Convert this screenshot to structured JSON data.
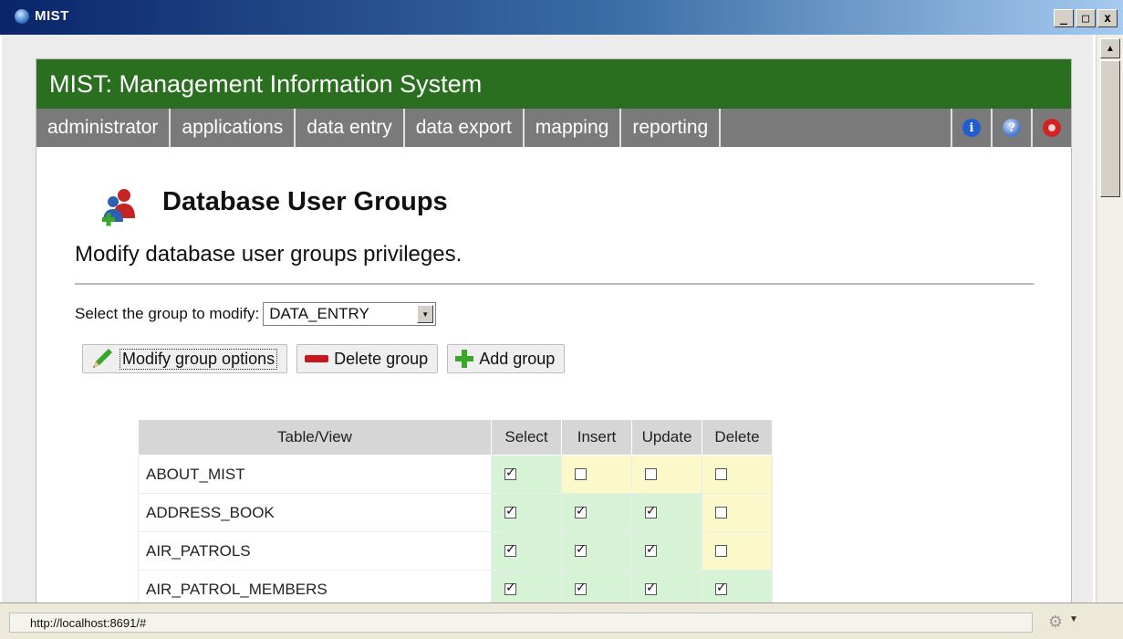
{
  "window": {
    "title": "MIST",
    "buttons": {
      "minimize": "_",
      "maximize": "□",
      "close": "x"
    }
  },
  "app": {
    "header_title": "MIST: Management Information System",
    "nav": [
      "administrator",
      "applications",
      "data entry",
      "data export",
      "mapping",
      "reporting"
    ],
    "nav_icons": [
      "info-icon",
      "help-icon",
      "exit-icon"
    ]
  },
  "page": {
    "title": "Database User Groups",
    "subtitle": "Modify database user groups privileges.",
    "select_label": "Select the group to modify:",
    "selected_group": "DATA_ENTRY",
    "buttons": {
      "modify": "Modify group options",
      "delete": "Delete group",
      "add": "Add group"
    }
  },
  "table": {
    "headers": [
      "Table/View",
      "Select",
      "Insert",
      "Update",
      "Delete"
    ],
    "rows": [
      {
        "name": "ABOUT_MIST",
        "select": true,
        "insert": false,
        "update": false,
        "delete": false
      },
      {
        "name": "ADDRESS_BOOK",
        "select": true,
        "insert": true,
        "update": true,
        "delete": false
      },
      {
        "name": "AIR_PATROLS",
        "select": true,
        "insert": true,
        "update": true,
        "delete": false
      },
      {
        "name": "AIR_PATROL_MEMBERS",
        "select": true,
        "insert": true,
        "update": true,
        "delete": true
      }
    ]
  },
  "status": {
    "url": "http://localhost:8691/#"
  },
  "colors": {
    "header_green": "#2a6f1f",
    "nav_gray": "#7a7a7a",
    "checked_cell": "#d7f3d5",
    "unchecked_cell": "#fbf9c9"
  }
}
